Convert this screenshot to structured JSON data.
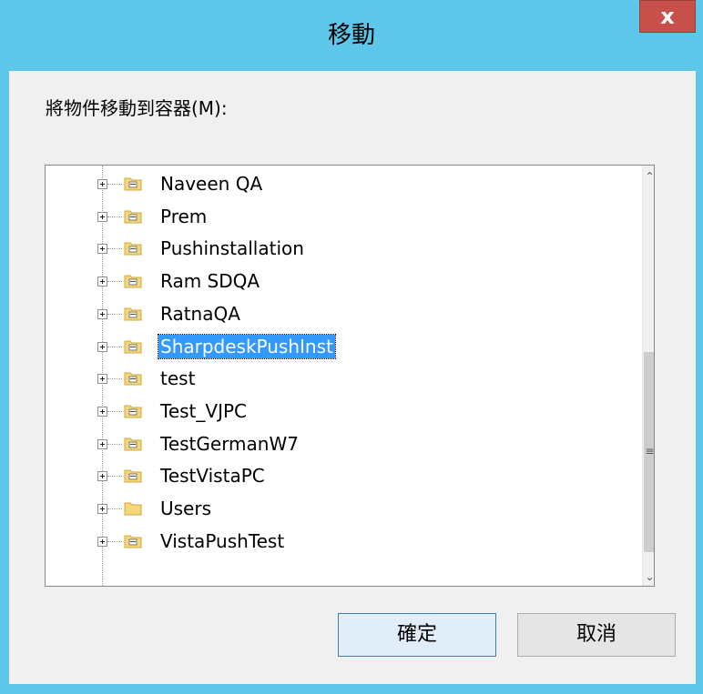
{
  "window": {
    "title": "移動",
    "close_label": "x"
  },
  "prompt": "將物件移動到容器(M):",
  "tree": {
    "items": [
      {
        "label": "Naveen QA",
        "selected": false
      },
      {
        "label": "Prem",
        "selected": false
      },
      {
        "label": "Pushinstallation",
        "selected": false
      },
      {
        "label": "Ram SDQA",
        "selected": false
      },
      {
        "label": "RatnaQA",
        "selected": false
      },
      {
        "label": "SharpdeskPushInst",
        "selected": true
      },
      {
        "label": "test",
        "selected": false
      },
      {
        "label": "Test_VJPC",
        "selected": false
      },
      {
        "label": "TestGermanW7",
        "selected": false
      },
      {
        "label": "TestVistaPC",
        "selected": false
      },
      {
        "label": "Users",
        "selected": false,
        "plain_folder": true
      },
      {
        "label": "VistaPushTest",
        "selected": false
      }
    ]
  },
  "buttons": {
    "ok_label": "確定",
    "cancel_label": "取消"
  },
  "colors": {
    "titlebar": "#5ec6e8",
    "close": "#c7504a",
    "selection": "#3399ff"
  }
}
